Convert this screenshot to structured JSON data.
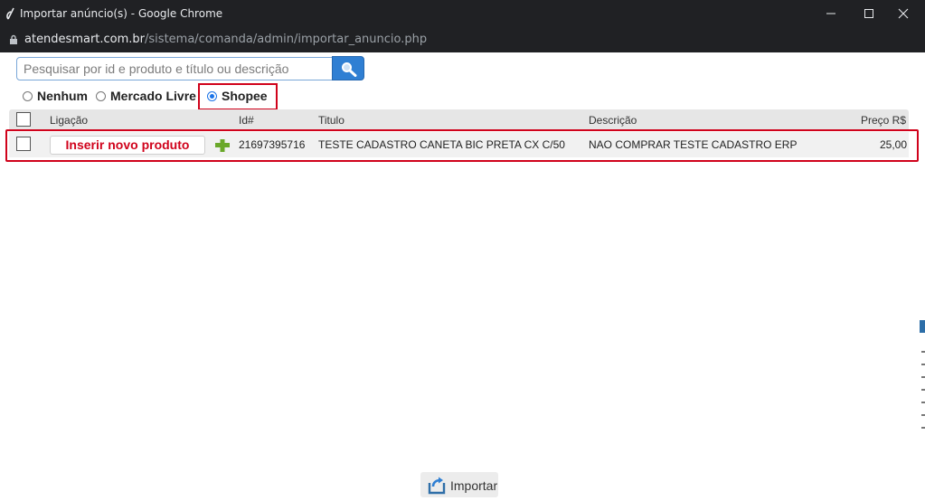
{
  "window": {
    "title": "Importar anúncio(s) - Google Chrome"
  },
  "address": {
    "host": "atendesmart.com.br",
    "path": "/sistema/comanda/admin/importar_anuncio.php"
  },
  "search": {
    "placeholder": "Pesquisar por id e produto e título ou descrição",
    "value": ""
  },
  "filters": {
    "options": [
      "Nenhum",
      "Mercado Livre",
      "Shopee"
    ],
    "selected": "Shopee"
  },
  "table": {
    "headers": {
      "ligacao": "Ligação",
      "id": "Id#",
      "titulo": "Titulo",
      "descricao": "Descrição",
      "preco": "Preço R$"
    },
    "rows": [
      {
        "action_label": "Inserir novo produto",
        "id": "21697395716",
        "titulo": "TESTE CADASTRO CANETA BIC PRETA CX C/50",
        "descricao": "NAO COMPRAR TESTE CADASTRO ERP",
        "preco": "25,00"
      }
    ]
  },
  "footer": {
    "import_label": "Importar"
  },
  "colors": {
    "highlight_border": "#d0021b",
    "search_button": "#2f7fd3",
    "titlebar": "#202124"
  },
  "icons": [
    "app-icon",
    "minimize-icon",
    "maximize-icon",
    "close-icon",
    "lock-icon",
    "search-icon",
    "plus-icon",
    "import-icon"
  ]
}
